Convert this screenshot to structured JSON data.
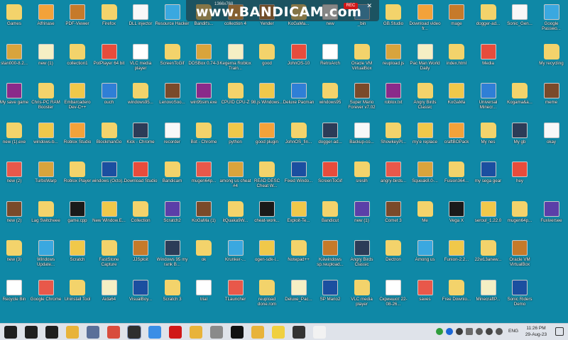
{
  "watermark": {
    "brand": "www.BANDICAM.com",
    "resolution": "1366x768",
    "rec_label": "REC",
    "close_label": "✕"
  },
  "desktop_icons": [
    [
      "Games",
      "Alfrinase",
      "PDF-Viewer",
      "Firefox",
      "DLL injector",
      "Resource Hacker",
      "Bandit's...",
      "collection 4",
      "Yender",
      "KoGaMa...",
      "new",
      "_bin",
      "GB.Studio",
      "Download video fr...",
      "mage",
      "dogger-ad...",
      "Sonic_Gen...",
      "Google Passwo..."
    ],
    [
      "stan000-8.2...",
      "new (1)",
      "collection1",
      "PotPlayer 64 bit",
      "VLC media player",
      "ScreenToGif",
      "DOSBox 0.74-3",
      "Kegerna Roblox Train...",
      "good",
      "JohnOS-10",
      "RetroArch",
      "Oracle VM VirtualBox",
      "reupload.js",
      "Pac Man World Daily",
      "index.html",
      "Media",
      "",
      "My recycling"
    ],
    [
      "My save game",
      "Chris-PC RAM Booster",
      "Embarcadero Dev-C++",
      "ouch",
      "windows95...",
      "LenovoSoo...",
      "win95sim.exe",
      "CPUID CPU-Z",
      "98.js Windows...",
      "Deluxe Pacman",
      "windows95",
      "Super Mario Forever v7.02",
      "roblox.txt",
      "Angry Birds Classic",
      "KoGaMa",
      "Universal Minecr...",
      "Kogama&a...",
      "meme"
    ],
    [
      "new (1).exe",
      "windows-b...",
      "Roblox Studio",
      "BlockmanGo",
      "Kick - Chrome",
      "recorder",
      "Bot - Chrome",
      "python",
      "good plugin",
      "JohnOS_fin...",
      "dogger-ad...",
      "Backup-co...",
      "ShowkeyPl...",
      "my'e replace",
      "craftBOPack",
      "My nes",
      "My gb",
      "okay"
    ],
    [
      "new (2)",
      "TurboWarp",
      "Roblox Player",
      "windows (Octo)...",
      "Download Studio",
      "Bandicam",
      "mugen64p...",
      "among us cheat #4",
      "READ DESC Cheat W...",
      "Fixed Windo...",
      "ScreenToGif",
      "sreslh",
      "angry-birds...",
      "Squeak8.0-...",
      "Fusion364...",
      "my sega gear",
      "hey",
      ""
    ],
    [
      "new (2)",
      "Lag Switcheee",
      "game.cpp",
      "New Window.E...",
      "Collection",
      "Scratch2",
      "KoGaMa (1)",
      "itQuaka9W...",
      "cheat-work...",
      "Exploit-Te...",
      "Bandicut",
      "new (1)",
      "Comet 3",
      "Me",
      "Vega X",
      "seroul_1.22.0",
      "mugen64p...",
      "Fuxiversee"
    ],
    [
      "new (3)",
      "Windows Update...",
      "Scratch",
      "FastStone Capture",
      "JJSploit",
      "Windows 95 my rank B...",
      "ok",
      "Krunker-...",
      "ogen-sdk-l...",
      "Notepad++",
      "Kiiiwindows sp.reupload...",
      "Angry Birds Classic",
      "Dectron",
      "Among us",
      "Funion-2.2...",
      "22w13anew...",
      "Oracle VM VirtualBox",
      ""
    ],
    [
      "Recycle Bin",
      "Google Chrome",
      "Uninstall Tool",
      "Aida64",
      "VisualBoy...",
      "Scratch 3",
      "trial",
      "TLauncher",
      "reupload done.rom",
      "Deluxe_Pac...",
      "SP Mario2",
      "VLC media player",
      "Скриншот 22-08-26...",
      "saves",
      "Free Downlo...",
      "MinecraftP...",
      "Sonic Riders Demo",
      ""
    ]
  ],
  "colors": {
    "desktop_bg": "#0f88a6",
    "taskbar_bg": "#dfe3ea",
    "accent": "#d01818"
  },
  "taskbar": {
    "items": [
      "windows-icon",
      "search-icon",
      "task-view-icon",
      "file-explorer-icon",
      "printer-icon",
      "paint-icon",
      "taskbar-active-app-icon",
      "photos-icon",
      "bandicam-icon",
      "chrome-icon",
      "mouse-icon",
      "tiktok-icon",
      "chrome-icon",
      "notes-icon",
      "capture-icon",
      "avatar-icon"
    ],
    "lang": "ENG",
    "time": "11:26 PM",
    "date": "29-Aug-23"
  }
}
